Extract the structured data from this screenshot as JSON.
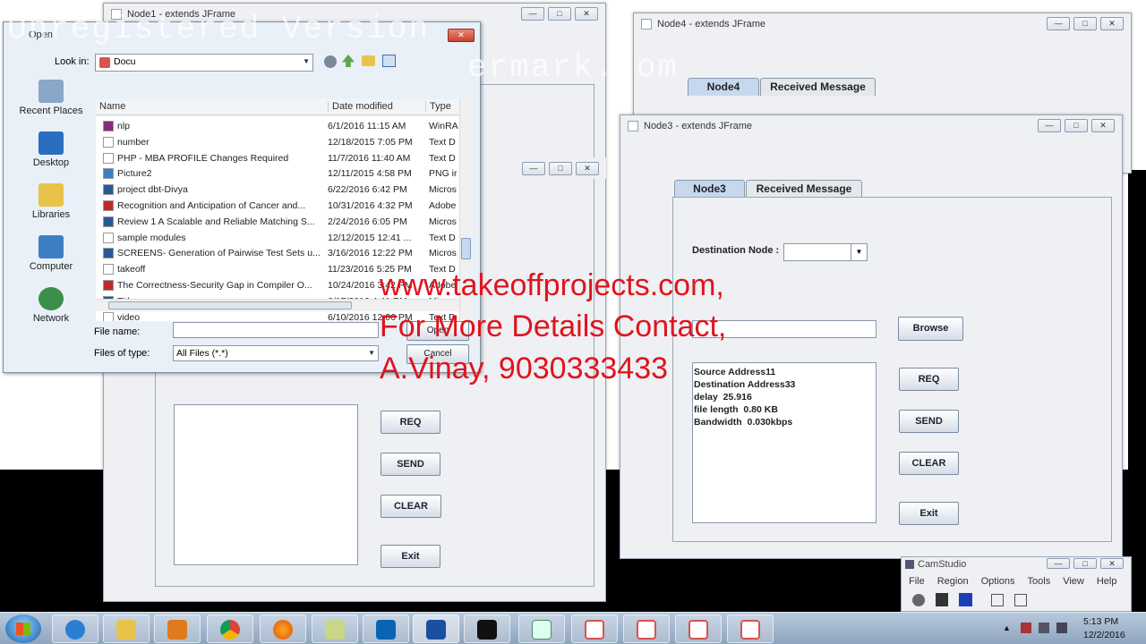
{
  "watermark": {
    "line1": "Unregistered Version",
    "line2": "ermark.com"
  },
  "overlay": {
    "line1": "www.takeoffprojects.com,",
    "line2": "For More Details Contact,",
    "line3": "A.Vinay, 9030333433"
  },
  "node1": {
    "title": "Node1 - extends JFrame",
    "buttons": {
      "req": "REQ",
      "send": "SEND",
      "clear": "CLEAR",
      "exit": "Exit"
    }
  },
  "node4": {
    "title": "Node4 - extends JFrame",
    "tabs": [
      "Node4",
      "Received Message"
    ]
  },
  "node3": {
    "title": "Node3 - extends JFrame",
    "tabs": [
      "Node3",
      "Received Message"
    ],
    "dest_label": "Destination Node :",
    "browse": "Browse",
    "log": [
      "Source Address11",
      "Destination Address33",
      "delay  25.916",
      "file length  0.80 KB",
      "Bandwidth  0.030kbps"
    ],
    "buttons": {
      "req": "REQ",
      "send": "SEND",
      "clear": "CLEAR",
      "exit": "Exit"
    }
  },
  "dialog": {
    "title": "Open",
    "look_in_label": "Look in:",
    "look_in_value": "Docu",
    "places": [
      "Recent Places",
      "Desktop",
      "Libraries",
      "Computer",
      "Network"
    ],
    "columns": [
      "Name",
      "Date modified",
      "Type"
    ],
    "files": [
      {
        "name": "nlp",
        "date": "6/1/2016 11:15 AM",
        "type": "WinRA",
        "kind": "rar"
      },
      {
        "name": "number",
        "date": "12/18/2015 7:05 PM",
        "type": "Text D",
        "kind": "txt"
      },
      {
        "name": "PHP - MBA PROFILE Changes Required",
        "date": "11/7/2016 11:40 AM",
        "type": "Text D",
        "kind": "txt"
      },
      {
        "name": "Picture2",
        "date": "12/11/2015 4:58 PM",
        "type": "PNG ir",
        "kind": "img"
      },
      {
        "name": "project dbt-Divya",
        "date": "6/22/2016 6:42 PM",
        "type": "Micros",
        "kind": "doc"
      },
      {
        "name": "Recognition and Anticipation of Cancer and...",
        "date": "10/31/2016 4:32 PM",
        "type": "Adobe",
        "kind": "pdf"
      },
      {
        "name": "Review 1 A Scalable and Reliable Matching S...",
        "date": "2/24/2016 6:05 PM",
        "type": "Micros",
        "kind": "doc"
      },
      {
        "name": "sample modules",
        "date": "12/12/2015 12:41 ...",
        "type": "Text D",
        "kind": "txt"
      },
      {
        "name": "SCREENS- Generation of Pairwise Test Sets u...",
        "date": "3/16/2016 12:22 PM",
        "type": "Micros",
        "kind": "doc"
      },
      {
        "name": "takeoff",
        "date": "11/23/2016 5:25 PM",
        "type": "Text D",
        "kind": "txt"
      },
      {
        "name": "The Correctness-Security Gap in Compiler O...",
        "date": "10/24/2016 3:42 PM",
        "type": "Adobe",
        "kind": "pdf"
      },
      {
        "name": "Titles",
        "date": "6/17/2016 4:41 PM",
        "type": "Micros",
        "kind": "doc"
      },
      {
        "name": "video",
        "date": "6/10/2016 12:06 PM",
        "type": "Text D",
        "kind": "txt"
      }
    ],
    "file_name_label": "File name:",
    "file_name_value": "",
    "files_of_type_label": "Files of type:",
    "files_of_type_value": "All Files (*.*)",
    "open": "Open",
    "cancel": "Cancel"
  },
  "camstudio": {
    "title": "CamStudio",
    "menu": [
      "File",
      "Region",
      "Options",
      "Tools",
      "View",
      "Help"
    ]
  },
  "tray": {
    "time": "5:13 PM",
    "date": "12/2/2016"
  },
  "colors": {
    "overlay_red": "#e0141c",
    "tab_active": "#c6d8ee",
    "window_bg": "#eef0f4"
  }
}
